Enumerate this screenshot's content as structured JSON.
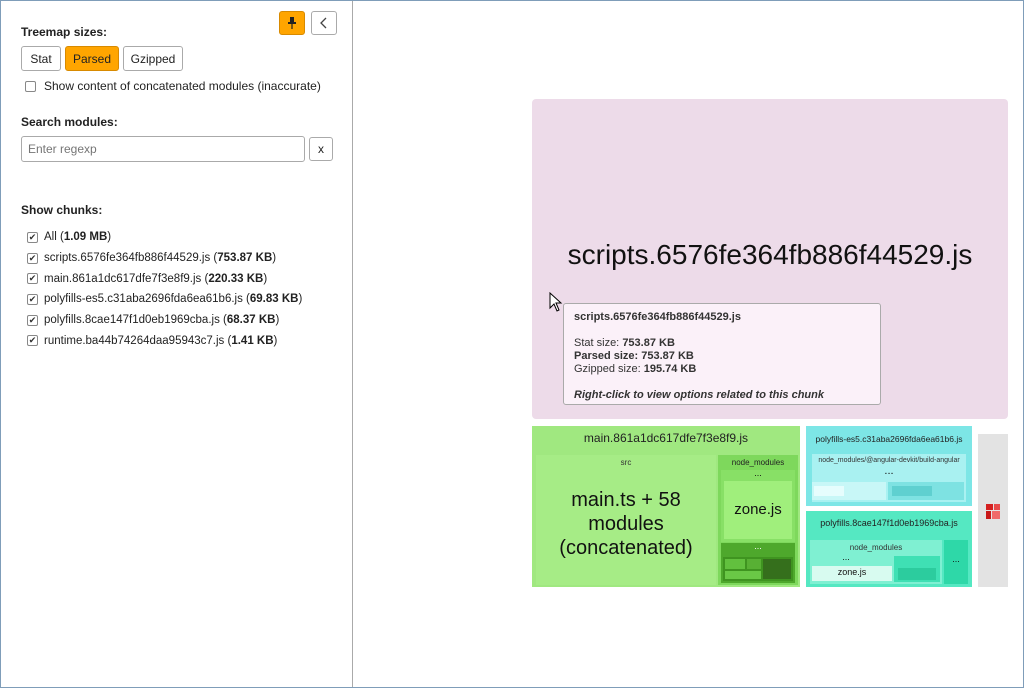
{
  "sidebar": {
    "treemap_sizes_label": "Treemap sizes:",
    "size_buttons": [
      {
        "label": "Stat",
        "active": false
      },
      {
        "label": "Parsed",
        "active": true
      },
      {
        "label": "Gzipped",
        "active": false
      }
    ],
    "concat_label": "Show content of concatenated modules (inaccurate)",
    "search_label": "Search modules:",
    "search_placeholder": "Enter regexp",
    "search_value": "",
    "clear_label": "x",
    "chunks_label": "Show chunks:",
    "chunks": [
      {
        "name": "All",
        "size": "1.09 MB",
        "checked": true
      },
      {
        "name": "scripts.6576fe364fb886f44529.js",
        "size": "753.87 KB",
        "checked": true
      },
      {
        "name": "main.861a1dc617dfe7f3e8f9.js",
        "size": "220.33 KB",
        "checked": true
      },
      {
        "name": "polyfills-es5.c31aba2696fda6ea61b6.js",
        "size": "69.83 KB",
        "checked": true
      },
      {
        "name": "polyfills.8cae147f1d0eb1969cba.js",
        "size": "68.37 KB",
        "checked": true
      },
      {
        "name": "runtime.ba44b74264daa95943c7.js",
        "size": "1.41 KB",
        "checked": true
      }
    ],
    "icons": {
      "pin": "pin-icon",
      "collapse": "chevron-left-icon"
    }
  },
  "treemap": {
    "scripts_label": "scripts.6576fe364fb886f44529.js",
    "main_label": "main.861a1dc617dfe7f3e8f9.js",
    "src_label": "src",
    "concat_module_label": "main.ts + 58 modules (concatenated)",
    "node_modules_label": "node_modules",
    "zone_label": "zone.js",
    "ellipsis": "...",
    "polyfills_es5_label": "polyfills-es5.c31aba2696fda6ea61b6.js",
    "es5_nm_label": "node_modules/@angular-devkit/build-angular",
    "polyfills_label": "polyfills.8cae147f1d0eb1969cba.js",
    "poly_nm_label": "node_modules",
    "zone2_label": "zone.js",
    "colors": {
      "scripts": "#eddbe9",
      "main": "#a0e880",
      "polyfills_es5": "#7de6e6",
      "polyfills": "#55e8c2",
      "runtime": "#e3e3e3",
      "accent": "#ffa500"
    }
  },
  "tooltip": {
    "title": "scripts.6576fe364fb886f44529.js",
    "stat_label": "Stat size:",
    "stat_value": "753.87 KB",
    "parsed_label": "Parsed size:",
    "parsed_value": "753.87 KB",
    "gzip_label": "Gzipped size:",
    "gzip_value": "195.74 KB",
    "hint": "Right-click to view options related to this chunk"
  }
}
